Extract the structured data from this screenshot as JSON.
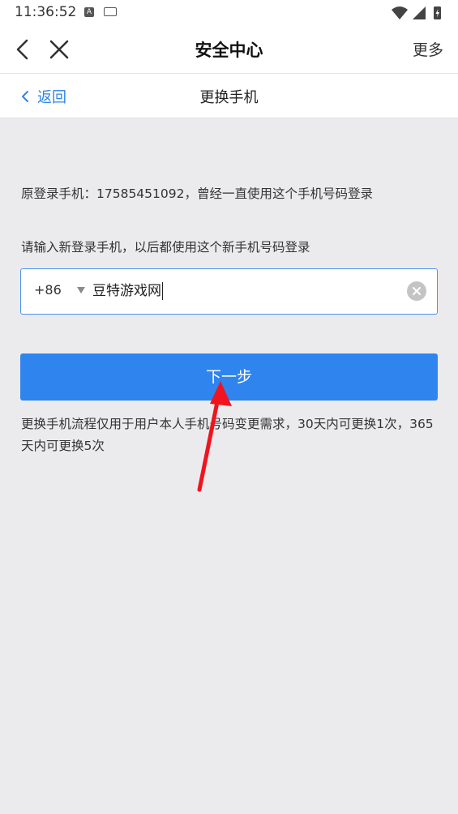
{
  "status_bar": {
    "time": "11:36:52",
    "notification_badge": "A"
  },
  "title_bar": {
    "title": "安全中心",
    "more_label": "更多"
  },
  "sub_nav": {
    "back_label": "返回",
    "title": "更换手机"
  },
  "content": {
    "old_phone_text": "原登录手机：17585451092，曾经一直使用这个手机号码登录",
    "new_phone_hint": "请输入新登录手机，以后都使用这个新手机号码登录",
    "country_code": "+86",
    "phone_input_value": "豆特游戏网",
    "next_button_label": "下一步",
    "notice_text": "更换手机流程仅用于用户本人手机号码变更需求，30天内可更换1次，365天内可更换5次"
  },
  "colors": {
    "accent": "#2f84ee",
    "annotation_arrow": "#f0141e",
    "page_background": "#ebebee"
  }
}
